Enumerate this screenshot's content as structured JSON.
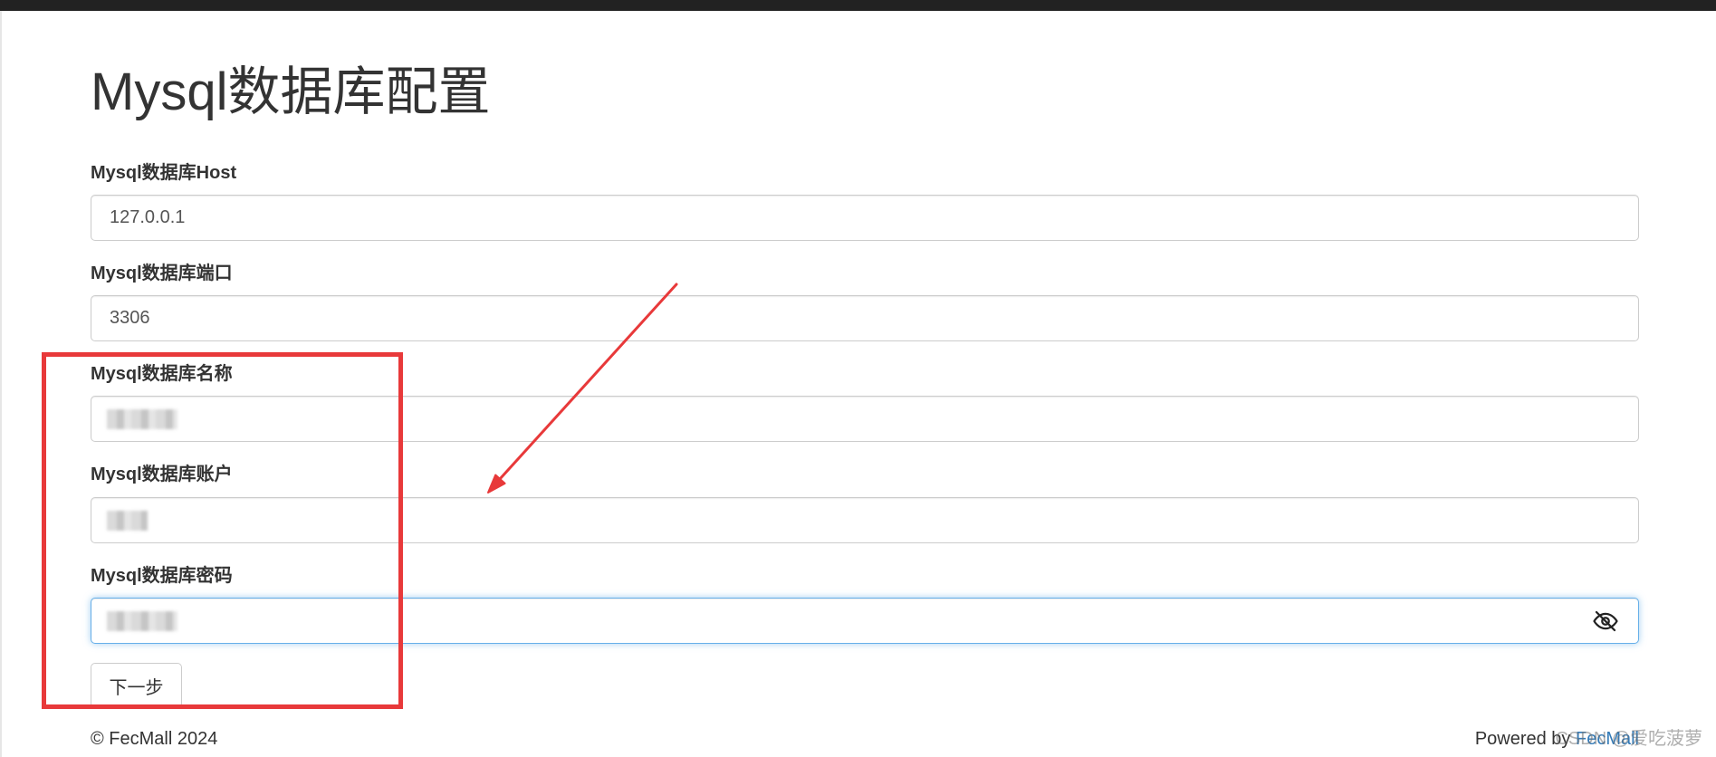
{
  "page": {
    "title": "Mysql数据库配置"
  },
  "form": {
    "fields": [
      {
        "label": "Mysql数据库Host",
        "value": "127.0.0.1"
      },
      {
        "label": "Mysql数据库端口",
        "value": "3306"
      },
      {
        "label": "Mysql数据库名称",
        "value": "",
        "redacted": true
      },
      {
        "label": "Mysql数据库账户",
        "value": "",
        "redacted": true
      },
      {
        "label": "Mysql数据库密码",
        "value": "",
        "redacted": true,
        "focused": true,
        "toggle_icon": "eye-slash-icon"
      }
    ],
    "submit_label": "下一步"
  },
  "footer": {
    "copyright": "© FecMall 2024",
    "powered_prefix": "Powered by ",
    "powered_link": "FecMall"
  },
  "watermark": "CSDN @爱吃菠萝",
  "colors": {
    "topbar": "#222222",
    "link": "#337ab7",
    "focus_border": "#66afe9",
    "annotation": "#e8393a"
  }
}
